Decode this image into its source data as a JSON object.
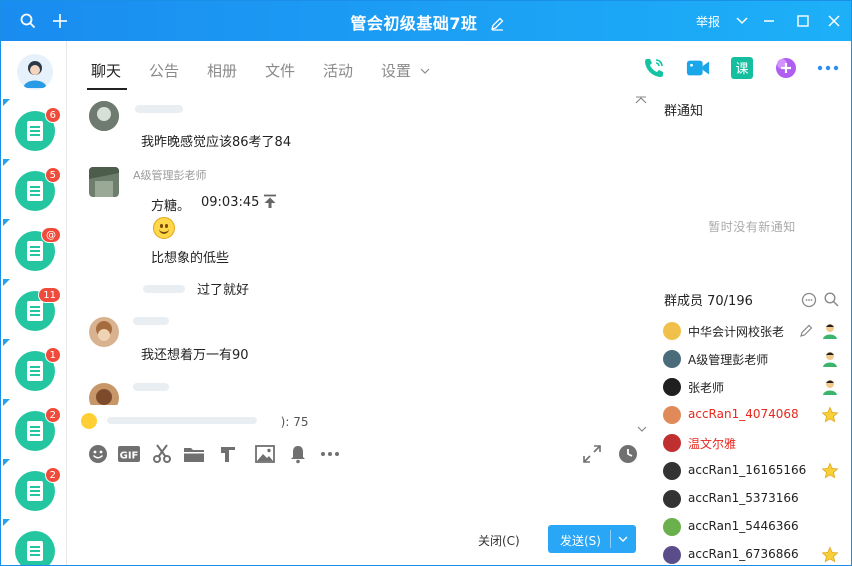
{
  "window": {
    "title": "管会初级基础7班",
    "report_label": "举报",
    "accent": "#1a8cf0"
  },
  "rail": {
    "conversations": [
      {
        "badge": "6"
      },
      {
        "badge": "5"
      },
      {
        "badge": "@"
      },
      {
        "badge": "11"
      },
      {
        "badge": "1"
      },
      {
        "badge": "2"
      },
      {
        "badge": "2"
      },
      {
        "badge": ""
      }
    ]
  },
  "tabs": [
    {
      "label": "聊天",
      "active": true
    },
    {
      "label": "公告",
      "active": false
    },
    {
      "label": "相册",
      "active": false
    },
    {
      "label": "文件",
      "active": false
    },
    {
      "label": "活动",
      "active": false
    },
    {
      "label": "设置",
      "active": false
    }
  ],
  "top_icons": [
    "phone-icon",
    "video-icon",
    "course-icon",
    "plus-app-icon",
    "more-icon"
  ],
  "messages": [
    {
      "text": "我昨晚感觉应该86考了84"
    },
    {
      "sender": "A级管理彭老师",
      "text": "方糖。",
      "time": "09:03:45",
      "extra": "比想象的低些"
    },
    {
      "text": "过了就好"
    },
    {
      "text": "我还想着万一有90"
    },
    {
      "text": ""
    }
  ],
  "input": {
    "bottom_preview": "): 75",
    "tools": [
      "emoji-icon",
      "gif-icon",
      "scissors-icon",
      "folder-icon",
      "music-icon",
      "image-icon",
      "bell-icon",
      "more-dots-icon"
    ],
    "close_label": "关闭(C)",
    "send_label": "发送(S)"
  },
  "right_panel": {
    "notice_title": "群通知",
    "no_notice": "暂时没有新通知",
    "members_title": "群成员 70/196",
    "members": [
      {
        "name": "中华会计网校张老",
        "color": "normal",
        "role": "admin"
      },
      {
        "name": "A级管理彭老师",
        "color": "normal",
        "role": "admin"
      },
      {
        "name": "张老师",
        "color": "normal",
        "role": "admin"
      },
      {
        "name": "accRan1_4074068",
        "color": "red",
        "role": "star"
      },
      {
        "name": "温文尔雅",
        "color": "red",
        "role": ""
      },
      {
        "name": "accRan1_16165166",
        "color": "normal",
        "role": "star"
      },
      {
        "name": "accRan1_5373166",
        "color": "normal",
        "role": ""
      },
      {
        "name": "accRan1_5446366",
        "color": "normal",
        "role": ""
      },
      {
        "name": "accRan1_6736866",
        "color": "normal",
        "role": "star"
      }
    ]
  }
}
